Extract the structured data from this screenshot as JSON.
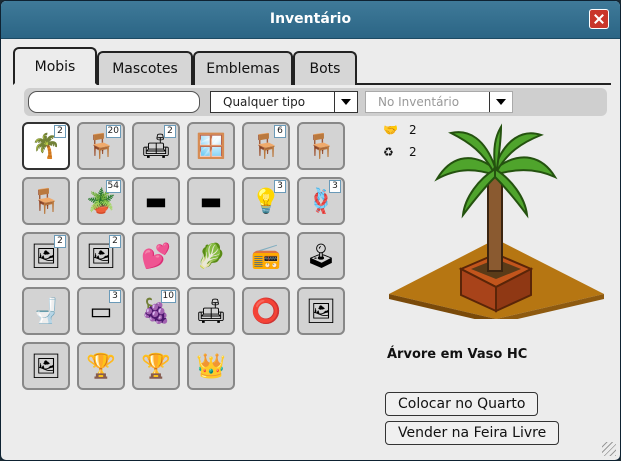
{
  "window": {
    "title": "Inventário"
  },
  "tabs": [
    {
      "label": "Mobis"
    },
    {
      "label": "Mascotes"
    },
    {
      "label": "Emblemas"
    },
    {
      "label": "Bots"
    }
  ],
  "filters": {
    "search_value": "",
    "type_select": "Qualquer tipo",
    "location_select": "No Inventário"
  },
  "items": [
    {
      "icon": "🌴",
      "count": "2"
    },
    {
      "icon": "🪑",
      "count": "20"
    },
    {
      "icon": "🛋",
      "count": "2"
    },
    {
      "icon": "🪟",
      "count": ""
    },
    {
      "icon": "🪑",
      "count": "6"
    },
    {
      "icon": "🪑",
      "count": ""
    },
    {
      "icon": "🪑",
      "count": ""
    },
    {
      "icon": "🪴",
      "count": "54"
    },
    {
      "icon": "▬",
      "count": ""
    },
    {
      "icon": "▬",
      "count": ""
    },
    {
      "icon": "💡",
      "count": "3"
    },
    {
      "icon": "🪢",
      "count": "3"
    },
    {
      "icon": "🖼",
      "count": "2"
    },
    {
      "icon": "🖼",
      "count": "2"
    },
    {
      "icon": "💕",
      "count": ""
    },
    {
      "icon": "🥬",
      "count": ""
    },
    {
      "icon": "📻",
      "count": ""
    },
    {
      "icon": "🕹",
      "count": ""
    },
    {
      "icon": "🚽",
      "count": ""
    },
    {
      "icon": "▭",
      "count": "3"
    },
    {
      "icon": "🍇",
      "count": "10"
    },
    {
      "icon": "🛋",
      "count": ""
    },
    {
      "icon": "⭕",
      "count": ""
    },
    {
      "icon": "🖼",
      "count": ""
    },
    {
      "icon": "🖼",
      "count": ""
    },
    {
      "icon": "🏆",
      "count": ""
    },
    {
      "icon": "🏆",
      "count": ""
    },
    {
      "icon": "👑",
      "count": ""
    }
  ],
  "stats": {
    "trade_count": "2",
    "recycle_count": "2"
  },
  "selected": {
    "name": "Árvore em Vaso HC"
  },
  "actions": {
    "place_label": "Colocar no Quarto",
    "sell_label": "Vender na Feira Livre"
  },
  "colors": {
    "title_bar": "#2b6585",
    "close": "#c9362b",
    "floor": "#b67612"
  }
}
